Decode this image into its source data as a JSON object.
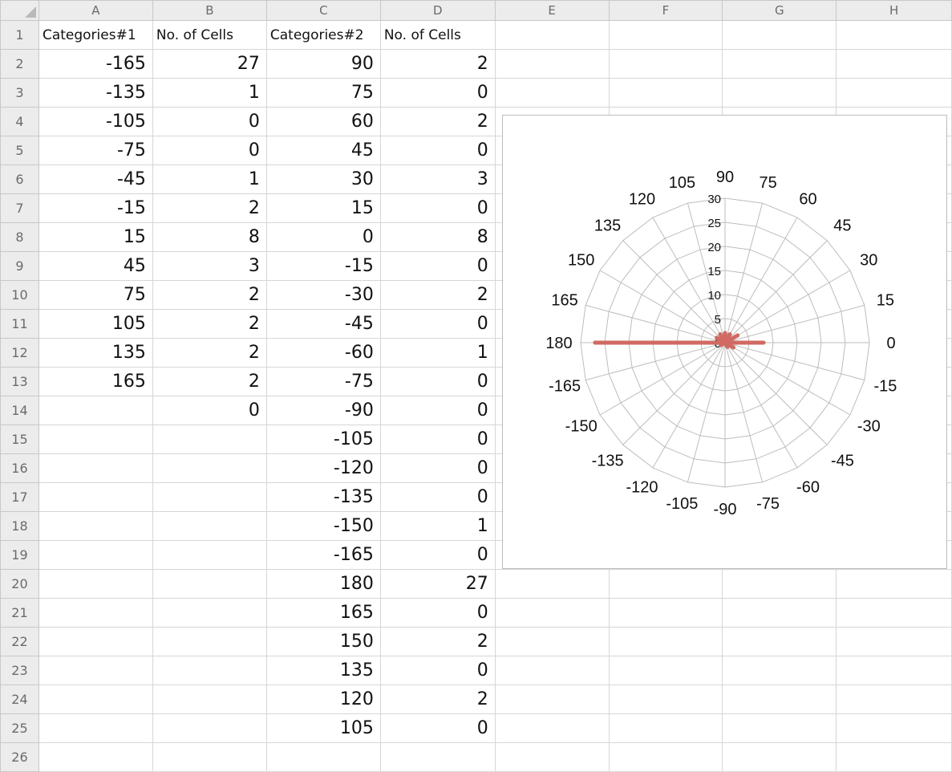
{
  "sheet": {
    "columns": [
      "A",
      "B",
      "C",
      "D",
      "E",
      "F",
      "G",
      "H"
    ],
    "visible_row_numbers": [
      "1",
      "2",
      "3",
      "4",
      "5",
      "6",
      "7",
      "8",
      "9",
      "10",
      "11",
      "12",
      "13",
      "14",
      "15",
      "16",
      "17",
      "18",
      "19",
      "20",
      "21",
      "22",
      "23",
      "24",
      "25",
      "26"
    ],
    "headers": {
      "A1": "Categories#1",
      "B1": "No. of Cells",
      "C1": "Categories#2",
      "D1": "No. of Cells"
    },
    "col_a": [
      "-165",
      "-135",
      "-105",
      "-75",
      "-45",
      "-15",
      "15",
      "45",
      "75",
      "105",
      "135",
      "165"
    ],
    "col_b": [
      "27",
      "1",
      "0",
      "0",
      "1",
      "2",
      "8",
      "3",
      "2",
      "2",
      "2",
      "2",
      "0"
    ],
    "col_c": [
      "90",
      "75",
      "60",
      "45",
      "30",
      "15",
      "0",
      "-15",
      "-30",
      "-45",
      "-60",
      "-75",
      "-90",
      "-105",
      "-120",
      "-135",
      "-150",
      "-165",
      "180",
      "165",
      "150",
      "135",
      "120",
      "105"
    ],
    "col_d": [
      "2",
      "0",
      "2",
      "0",
      "3",
      "0",
      "8",
      "0",
      "2",
      "0",
      "1",
      "0",
      "0",
      "0",
      "0",
      "0",
      "1",
      "0",
      "27",
      "0",
      "2",
      "0",
      "2",
      "0"
    ]
  },
  "chart_data": {
    "type": "radar",
    "categories": [
      "90",
      "75",
      "60",
      "45",
      "30",
      "15",
      "0",
      "-15",
      "-30",
      "-45",
      "-60",
      "-75",
      "-90",
      "-105",
      "-120",
      "-135",
      "-150",
      "-165",
      "180",
      "165",
      "150",
      "135",
      "120",
      "105"
    ],
    "series": [
      {
        "values": [
          2,
          0,
          2,
          0,
          3,
          0,
          8,
          0,
          2,
          0,
          1,
          0,
          0,
          0,
          0,
          0,
          1,
          0,
          27,
          0,
          2,
          0,
          2,
          0
        ],
        "color": "#d06a63"
      }
    ],
    "radial_ticks": [
      "0",
      "5",
      "10",
      "15",
      "20",
      "25",
      "30"
    ],
    "rmax": 30,
    "grid": true,
    "legend": "none"
  }
}
